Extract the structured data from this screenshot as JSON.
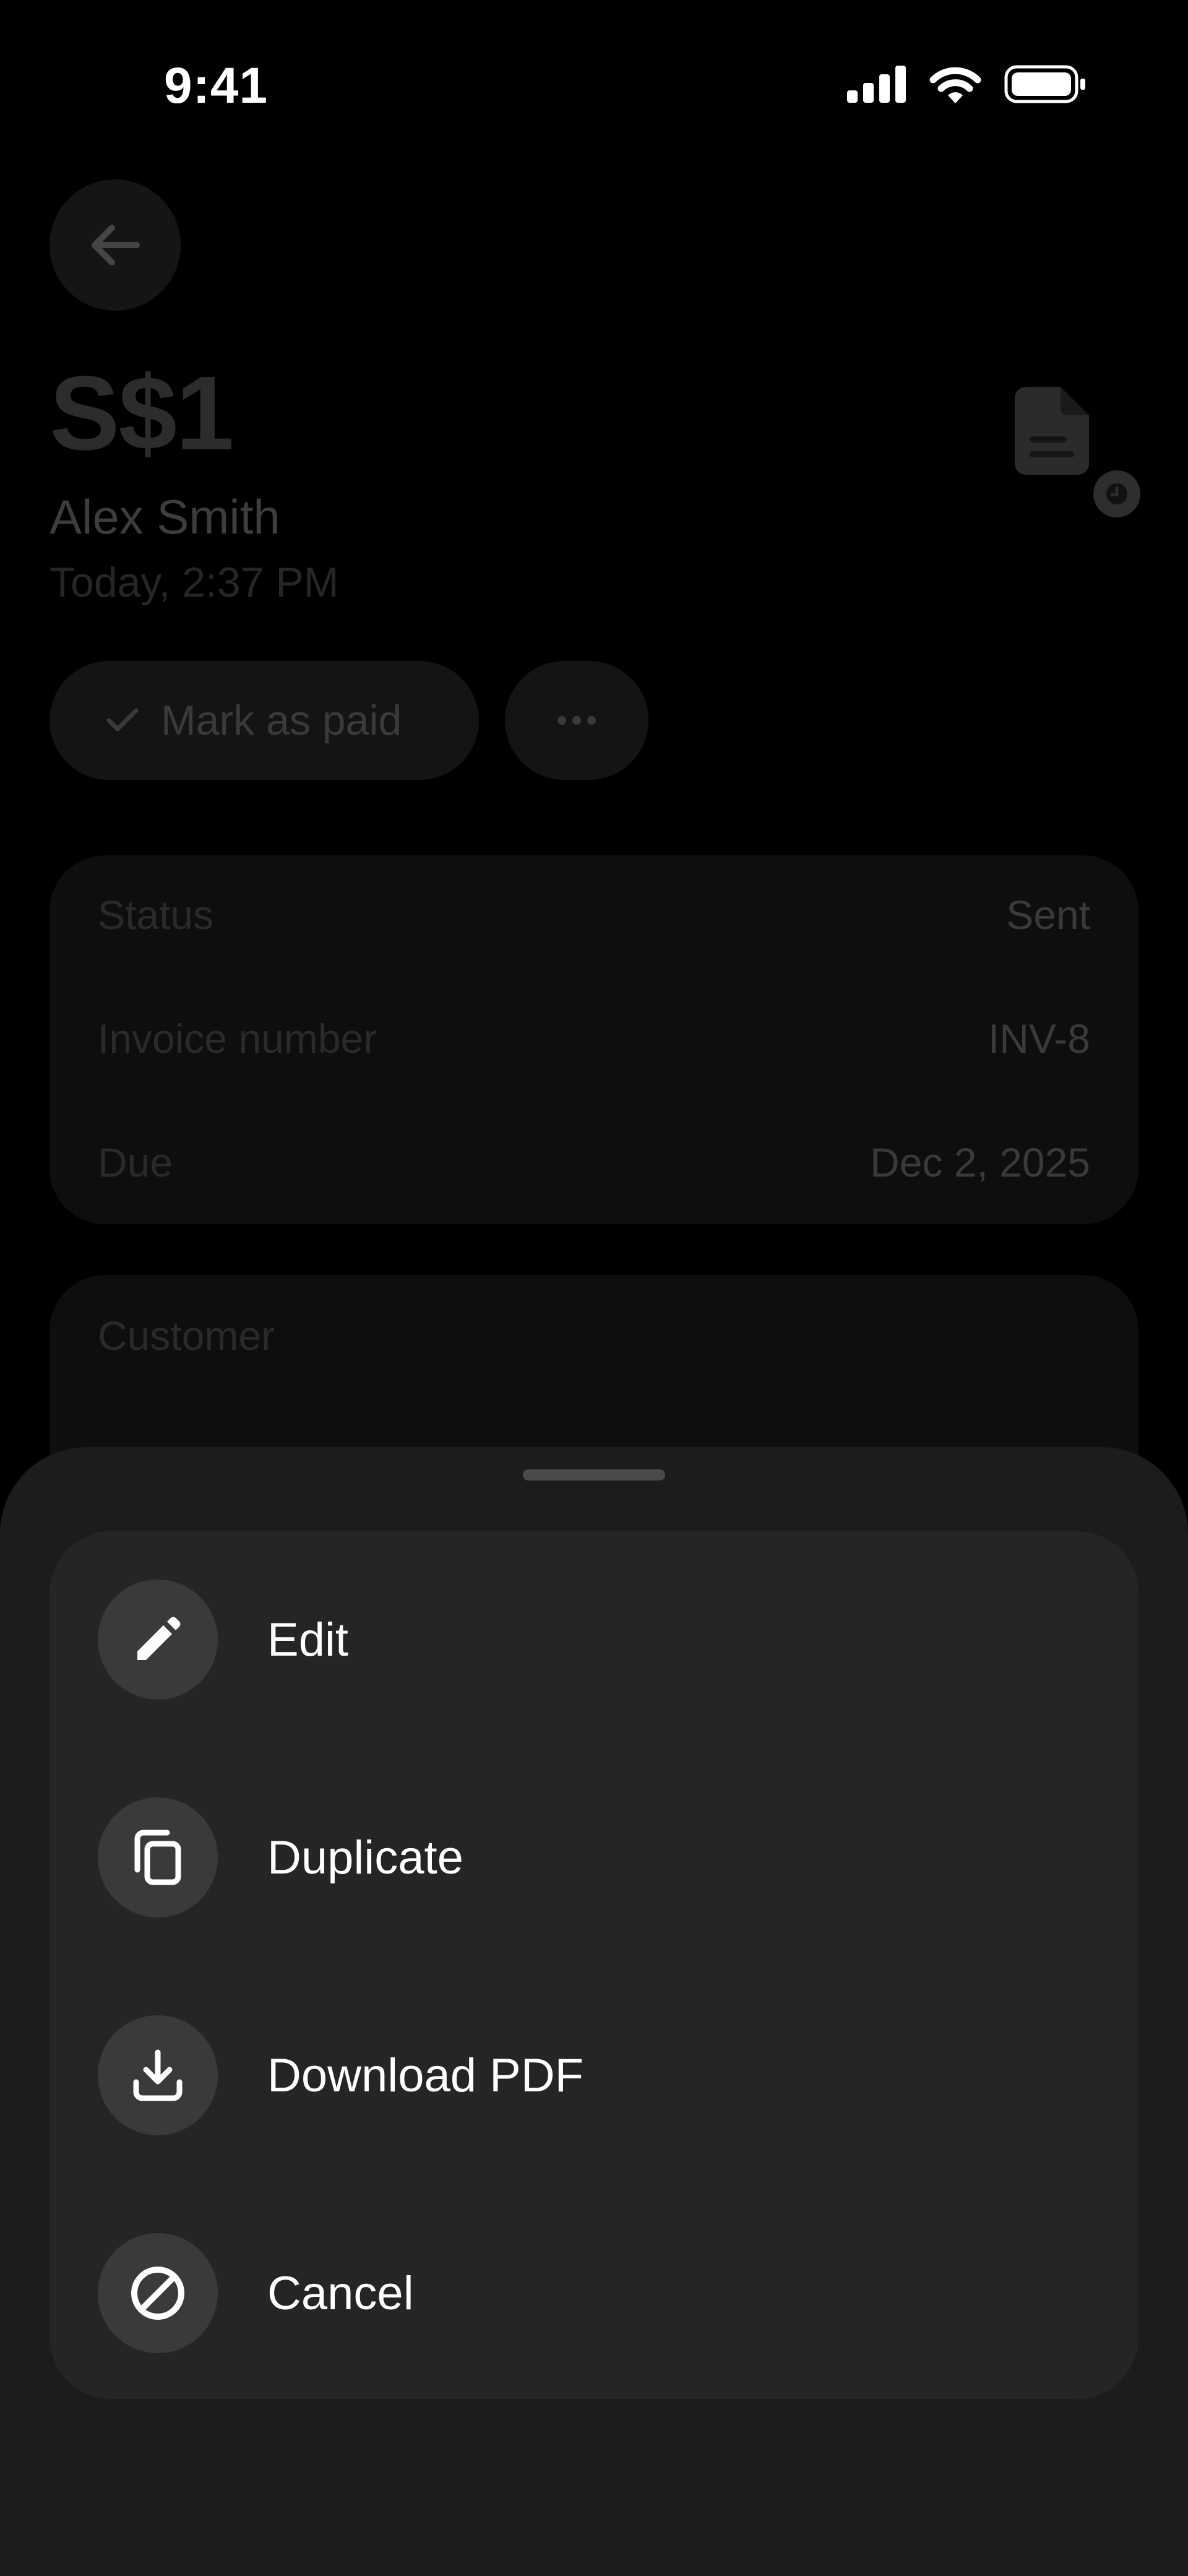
{
  "status_bar": {
    "time": "9:41"
  },
  "invoice": {
    "amount": "S$1",
    "customer_name": "Alex Smith",
    "created": "Today, 2:37 PM",
    "mark_paid_label": "Mark as paid",
    "more_label": "···",
    "details": [
      {
        "key": "Status",
        "value": "Sent"
      },
      {
        "key": "Invoice number",
        "value": "INV-8"
      },
      {
        "key": "Due",
        "value": "Dec 2, 2025"
      }
    ],
    "customer_section_title": "Customer"
  },
  "sheet": {
    "items": [
      {
        "label": "Edit",
        "icon": "pencil-icon"
      },
      {
        "label": "Duplicate",
        "icon": "duplicate-icon"
      },
      {
        "label": "Download PDF",
        "icon": "download-icon"
      },
      {
        "label": "Cancel",
        "icon": "cancel-icon"
      }
    ]
  },
  "colors": {
    "background": "#000000",
    "sheet": "#1c1c1e",
    "menu_card": "#252527",
    "icon_circle": "#3a3a3c"
  }
}
